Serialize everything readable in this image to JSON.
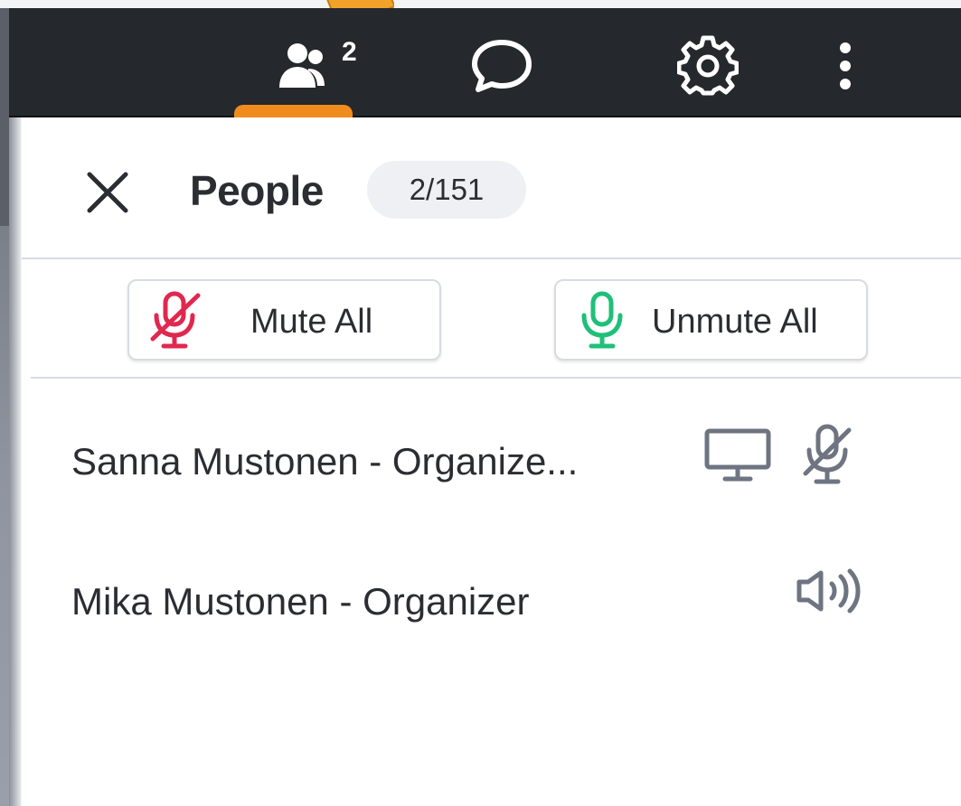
{
  "topbar": {
    "people_count": "2",
    "icons": {
      "people": "people-icon",
      "chat": "chat-icon",
      "settings": "gear-icon",
      "more": "more-vertical-icon"
    },
    "accent_color": "#f08c1e"
  },
  "panel": {
    "title": "People",
    "count": "2/151",
    "close_icon": "close-icon"
  },
  "actions": {
    "mute_all_label": "Mute All",
    "unmute_all_label": "Unmute All",
    "mute_color": "#e0284f",
    "unmute_color": "#1fbf7a"
  },
  "people": [
    {
      "name": "Sanna Mustonen - Organize...",
      "icons": [
        "screen-share-icon",
        "mic-off-icon"
      ]
    },
    {
      "name": "Mika Mustonen - Organizer",
      "icons": [
        "speaker-icon"
      ]
    }
  ]
}
